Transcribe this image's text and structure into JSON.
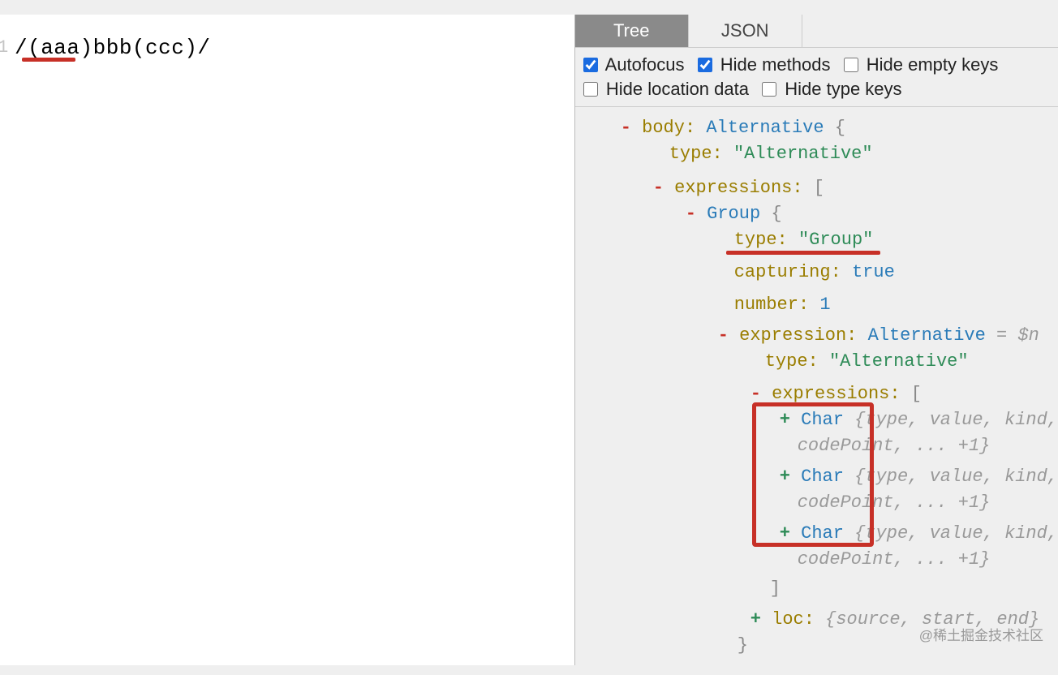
{
  "editor": {
    "line_number": "1",
    "code": "/(aaa)bbb(ccc)/"
  },
  "tabs": {
    "tree": "Tree",
    "json": "JSON"
  },
  "options": {
    "autofocus": {
      "label": "Autofocus",
      "checked": true
    },
    "hide_methods": {
      "label": "Hide methods",
      "checked": true
    },
    "hide_empty_keys": {
      "label": "Hide empty keys",
      "checked": false
    },
    "hide_location_data": {
      "label": "Hide location data",
      "checked": false
    },
    "hide_type_keys": {
      "label": "Hide type keys",
      "checked": false
    }
  },
  "tree": {
    "body_key": "body",
    "body_type": "Alternative",
    "type_key": "type",
    "type_value_alt": "\"Alternative\"",
    "expressions_key": "expressions",
    "group_name": "Group",
    "type_value_group": "\"Group\"",
    "capturing_key": "capturing",
    "capturing_val": "true",
    "number_key": "number",
    "number_val": "1",
    "expression_key": "expression",
    "expression_type": "Alternative",
    "eq_note": "= $n",
    "char_name": "Char",
    "char_summary1": "{type, value, kind,",
    "char_summary2": "codePoint, ... +1}",
    "close_bracket": "]",
    "loc_key": "loc",
    "loc_summary": "{source, start, end}",
    "close_brace": "}",
    "open_brace": "{",
    "open_bracket": "["
  },
  "watermark": "@稀土掘金技术社区"
}
